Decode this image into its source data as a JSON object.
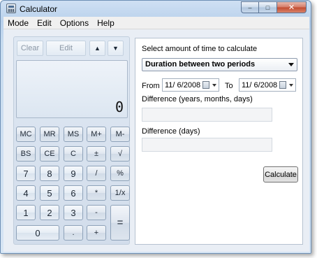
{
  "window": {
    "title": "Calculator",
    "controls": {
      "minimize": "–",
      "maximize": "□",
      "close": "✕"
    }
  },
  "menu": [
    "Mode",
    "Edit",
    "Options",
    "Help"
  ],
  "calculator": {
    "buttons": {
      "clear": "Clear",
      "edit": "Edit",
      "up_arrow": "▲",
      "down_arrow": "▼"
    },
    "display_value": "0",
    "keys": {
      "mc": "MC",
      "mr": "MR",
      "ms": "MS",
      "mplus": "M+",
      "mminus": "M-",
      "bs": "BS",
      "ce": "CE",
      "c": "C",
      "plusminus": "±",
      "sqrt": "√",
      "seven": "7",
      "eight": "8",
      "nine": "9",
      "divide": "/",
      "percent": "%",
      "four": "4",
      "five": "5",
      "six": "6",
      "multiply": "*",
      "reciprocal": "1/x",
      "one": "1",
      "two": "2",
      "three": "3",
      "subtract": "-",
      "zero": "0",
      "decimal": ".",
      "add": "+",
      "equals": "="
    }
  },
  "date_calc": {
    "heading": "Select amount of time to calculate",
    "mode_selected": "Duration between two periods",
    "from_label": "From",
    "from_value": "11/ 6/2008",
    "to_label": "To",
    "to_value": "11/ 6/2008",
    "diff_ymd_label": "Difference (years, months, days)",
    "diff_ymd_value": "",
    "diff_days_label": "Difference (days)",
    "diff_days_value": "",
    "calculate_label": "Calculate"
  }
}
